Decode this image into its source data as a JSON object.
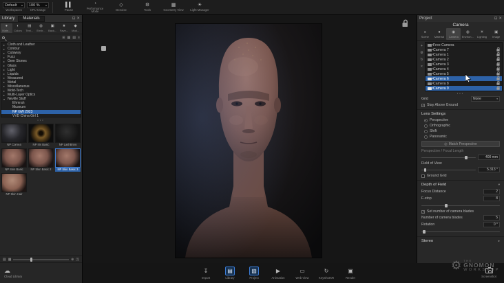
{
  "topbar": {
    "workspaces": {
      "value": "Default",
      "caption": "Workspaces"
    },
    "cpu": {
      "value": "100 %",
      "caption": "CPU Usage"
    },
    "buttons": [
      {
        "name": "pause",
        "glyph": "▌▌",
        "label": "Pause"
      },
      {
        "name": "performance-mode",
        "glyph": "◔",
        "label": "Performance Mode"
      },
      {
        "name": "denoise",
        "glyph": "◇",
        "label": "Denoise"
      },
      {
        "name": "tools",
        "glyph": "⚙",
        "label": "Tools"
      },
      {
        "name": "geometry-view",
        "glyph": "▦",
        "label": "Geometry View"
      },
      {
        "name": "light-manager",
        "glyph": "☀",
        "label": "Light Manager"
      }
    ]
  },
  "library": {
    "title": "Library",
    "tab": "Materials",
    "float_icon": "⊡",
    "close_icon": "✕",
    "subtabs": [
      {
        "glyph": "●",
        "label": "Mate...",
        "active": true
      },
      {
        "glyph": "◐",
        "label": "Colors"
      },
      {
        "glyph": "▤",
        "label": "Text..."
      },
      {
        "glyph": "◍",
        "label": "Envir..."
      },
      {
        "glyph": "▣",
        "label": "Back..."
      },
      {
        "glyph": "★",
        "label": "Fave..."
      },
      {
        "glyph": "◆",
        "label": "Mod..."
      }
    ],
    "search_icons": [
      {
        "glyph": "⊞"
      },
      {
        "glyph": "▦"
      },
      {
        "glyph": "▤"
      },
      {
        "glyph": "≡"
      }
    ],
    "tree": [
      {
        "label": "Cloth and Leather",
        "depth": 0,
        "arrow": "▸"
      },
      {
        "label": "Contour",
        "depth": 0,
        "arrow": "▸"
      },
      {
        "label": "Cutaway",
        "depth": 0,
        "arrow": "▸"
      },
      {
        "label": "Fuzz",
        "depth": 0,
        "arrow": "▸"
      },
      {
        "label": "Gem Stones",
        "depth": 0,
        "arrow": "▸"
      },
      {
        "label": "Glass",
        "depth": 0,
        "arrow": "▸"
      },
      {
        "label": "Light",
        "depth": 0,
        "arrow": "▸"
      },
      {
        "label": "Liquids",
        "depth": 0,
        "arrow": "▸"
      },
      {
        "label": "Measured",
        "depth": 0,
        "arrow": "▸"
      },
      {
        "label": "Metal",
        "depth": 0,
        "arrow": "▸"
      },
      {
        "label": "Miscellaneous",
        "depth": 0,
        "arrow": "▸"
      },
      {
        "label": "Mold-Tech",
        "depth": 0,
        "arrow": "▸"
      },
      {
        "label": "Multi-Layer Optics",
        "depth": 0,
        "arrow": "▸"
      },
      {
        "label": "Neville Stuff",
        "depth": 0,
        "arrow": "▾"
      },
      {
        "label": "Ehmrah",
        "depth": 1,
        "arrow": ""
      },
      {
        "label": "Museum",
        "depth": 1,
        "arrow": ""
      },
      {
        "label": "NP GW 2023",
        "depth": 1,
        "arrow": "",
        "selected": true
      },
      {
        "label": "VVD China Girl 1",
        "depth": 1,
        "arrow": ""
      }
    ],
    "dots": "•••",
    "thumbnails": [
      {
        "label": "NP Cornea",
        "kind": "cornea"
      },
      {
        "label": "NP Iris Basic",
        "kind": "iris"
      },
      {
        "label": "NP LashBrow",
        "kind": "lash"
      },
      {
        "label": "NP Skin Basic",
        "kind": "skin"
      },
      {
        "label": "NP Skin Basic 2",
        "kind": "skin"
      },
      {
        "label": "NP Skin Basic 3",
        "kind": "skin",
        "selected": true
      },
      {
        "label": "NP Skin Hair",
        "kind": "skinball"
      }
    ],
    "tools": {
      "left1": "▤",
      "left2": "▦",
      "zoom": "⊕",
      "expand": "◳"
    },
    "cloud": {
      "glyph": "☁",
      "label": "Cloud Library"
    }
  },
  "project": {
    "title": "Project",
    "float_icon": "⊡",
    "close_icon": "✕",
    "panel_title": "Camera",
    "tabs": [
      {
        "glyph": "≡",
        "label": "Scene"
      },
      {
        "glyph": "●",
        "label": "Material"
      },
      {
        "glyph": "◉",
        "label": "Camera",
        "active": true
      },
      {
        "glyph": "◍",
        "label": "Environ..."
      },
      {
        "glyph": "☀",
        "label": "Lighting"
      },
      {
        "glyph": "▣",
        "label": "Image"
      }
    ],
    "strip_icons": [
      {
        "name": "add-camera-icon",
        "glyph": "+"
      },
      {
        "name": "camera-settings-icon",
        "glyph": "⚙"
      },
      {
        "name": "reset-camera-icon",
        "glyph": "↻"
      },
      {
        "name": "delete-camera-icon",
        "glyph": "×"
      }
    ],
    "cameras": [
      {
        "label": "Free Camera",
        "locked": false
      },
      {
        "label": "Camera 7",
        "locked": true
      },
      {
        "label": "Camera 1",
        "locked": true
      },
      {
        "label": "Camera 2",
        "locked": true
      },
      {
        "label": "Camera 3",
        "locked": true
      },
      {
        "label": "Camera 4",
        "locked": true
      },
      {
        "label": "Camera 5",
        "locked": true
      },
      {
        "label": "Camera 6",
        "locked": true,
        "selected": true
      },
      {
        "label": "Camera 8",
        "locked": true
      },
      {
        "label": "Camera 9",
        "locked": true,
        "selected": true
      }
    ],
    "dots": "•••",
    "grid": {
      "label": "Grid",
      "value": "None"
    },
    "stay_above_ground": "Stay Above Ground",
    "lens": {
      "header": "Lens Settings",
      "radios": [
        {
          "label": "Perspective",
          "on": true
        },
        {
          "label": "Orthographic",
          "on": false
        },
        {
          "label": "Shift",
          "on": false
        },
        {
          "label": "Panoramic",
          "on": false
        }
      ],
      "match_button": "Match Perspective",
      "focal": {
        "label": "Perspective / Focal Length",
        "value": "400 mm"
      },
      "fov": {
        "label": "Field of View",
        "value": "5.313 °"
      },
      "ground_grid": "Ground Grid"
    },
    "dof": {
      "header": "Depth of Field",
      "focus_distance": {
        "label": "Focus Distance",
        "value": "2"
      },
      "fstop": {
        "label": "F-stop",
        "value": "8"
      },
      "blades_check": "Set number of camera blades",
      "blades": {
        "label": "Number of camera blades",
        "value": "5"
      },
      "rotation": {
        "label": "Rotation",
        "value": "0 °"
      }
    },
    "stereo_header": "Stereo"
  },
  "ribbon": {
    "items": [
      {
        "glyph": "↧",
        "label": "Import"
      },
      {
        "glyph": "▤",
        "label": "Library",
        "active": true
      },
      {
        "glyph": "▧",
        "label": "Project",
        "active": true
      },
      {
        "glyph": "▶",
        "label": "Animation"
      },
      {
        "glyph": "▭",
        "label": "Web View"
      },
      {
        "glyph": "↻",
        "label": "KeyShotXR"
      },
      {
        "glyph": "▣",
        "label": "Render"
      }
    ],
    "screenshot": "Screenshot"
  },
  "watermark": {
    "the": "THE",
    "gnomon": "GNOMON",
    "workshop": "WORKSHOP",
    "gear": "⚙"
  }
}
